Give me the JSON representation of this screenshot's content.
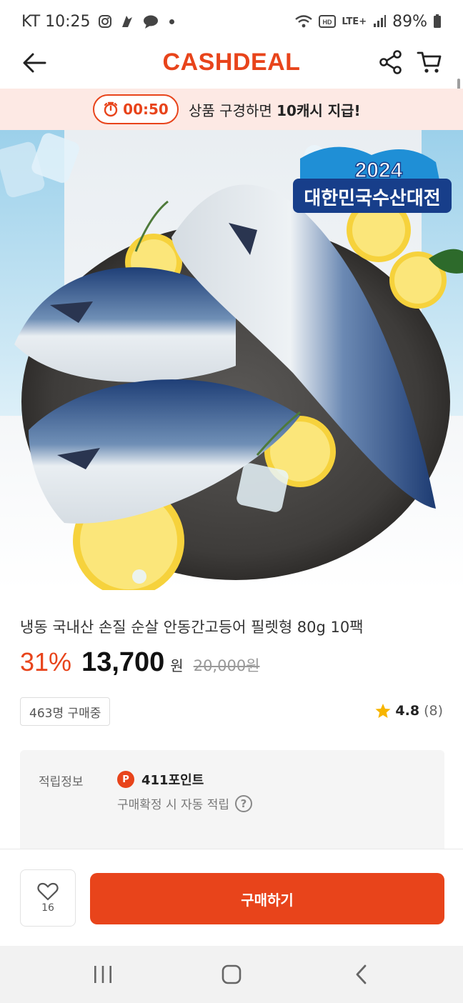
{
  "status_bar": {
    "carrier_time": "KT 10:25",
    "network": "LTE+",
    "battery": "89%"
  },
  "header": {
    "logo": "CASHDEAL"
  },
  "promo": {
    "timer": "00:50",
    "text_prefix": "상품 구경하면 ",
    "text_bold": "10캐시 지급!"
  },
  "product": {
    "title": "냉동 국내산 손질 순살 안동간고등어 필렛형 80g 10팩",
    "discount": "31%",
    "price": "13,700",
    "currency": "원",
    "original_price": "20,000원",
    "buyers": "463명 구매중",
    "rating": "4.8",
    "review_count": "(8)",
    "image_badge_year": "2024",
    "image_badge_title": "대한민국수산대전"
  },
  "points": {
    "label": "적립정보",
    "p_icon": "P",
    "value": "411포인트",
    "note": "구매확정 시 자동 적립",
    "help": "?"
  },
  "action_bar": {
    "like_count": "16",
    "buy_label": "구매하기"
  },
  "colors": {
    "accent": "#e8441b",
    "promo_bg": "#fde9e4"
  }
}
